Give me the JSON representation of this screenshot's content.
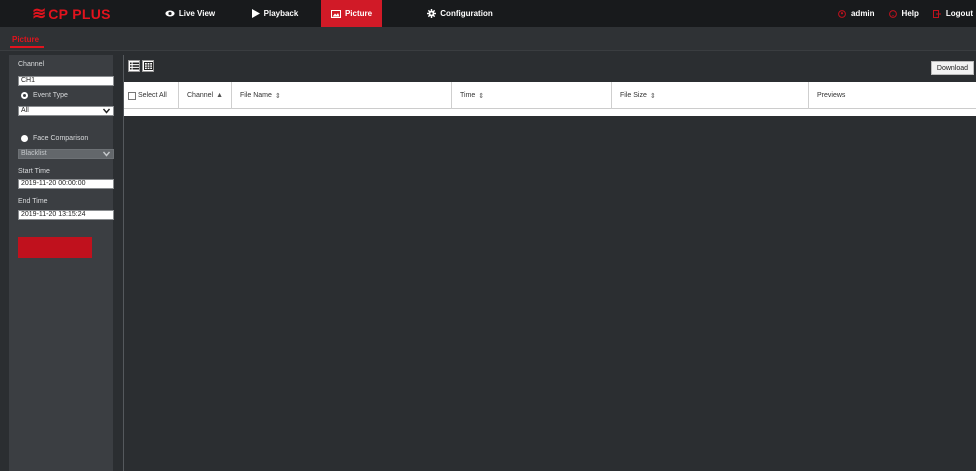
{
  "brand": {
    "mark": "≋",
    "name": "CP PLUS",
    "color": "#e1131d"
  },
  "nav": {
    "live_view": "Live View",
    "playback": "Playback",
    "picture": "Picture",
    "configuration": "Configuration",
    "active": "Picture"
  },
  "user": {
    "name": "admin",
    "help": "Help",
    "logout": "Logout"
  },
  "subtab": {
    "label": "Picture"
  },
  "sidebar": {
    "channel_label": "Channel",
    "channel_value": "CH1",
    "event_type_label": "Event Type",
    "event_type_value": "All",
    "face_comparison_label": "Face Comparison",
    "face_comparison_value": "Blacklist",
    "start_time_label": "Start Time",
    "start_time_value": "2019-11-20 00:00:00",
    "end_time_label": "End Time",
    "end_time_value": "2019-11-20 13:15:24"
  },
  "toolbar": {
    "download_label": "Download"
  },
  "table": {
    "select_all": "Select All",
    "columns": [
      {
        "label": "Channel",
        "sort": "▲"
      },
      {
        "label": "File Name",
        "sort": "⇕"
      },
      {
        "label": "Time",
        "sort": "⇕"
      },
      {
        "label": "File Size",
        "sort": "⇕"
      },
      {
        "label": "Previews",
        "sort": ""
      }
    ]
  },
  "icons": [
    "eye-icon",
    "play-icon",
    "picture-icon",
    "gear-icon",
    "user-icon",
    "help-icon",
    "logout-icon",
    "list-view-icon",
    "grid-view-icon",
    "checkbox-icon"
  ],
  "colors": {
    "accent": "#e1131d",
    "active_tab": "#d11a27",
    "topbar": "#181a1c",
    "sidebar": "#3b3e42",
    "background": "#2b2e31"
  }
}
